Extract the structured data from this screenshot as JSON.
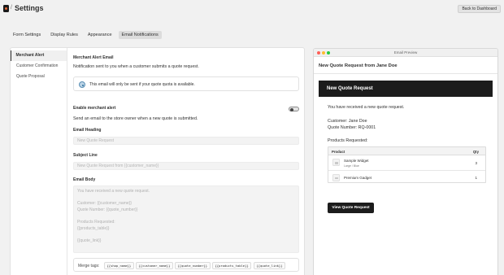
{
  "header": {
    "separator": "/",
    "title": "Settings",
    "back_button": "Back to Dashboard"
  },
  "tabs": [
    {
      "label": "Form Settings"
    },
    {
      "label": "Display Rules"
    },
    {
      "label": "Appearance"
    },
    {
      "label": "Email Notifications",
      "active": true
    }
  ],
  "sidebar": {
    "items": [
      {
        "label": "Merchant Alert",
        "active": true
      },
      {
        "label": "Customer Confirmation"
      },
      {
        "label": "Quote Proposal"
      }
    ]
  },
  "merchant_alert": {
    "title": "Merchant Alert Email",
    "description": "Notification sent to you when a customer submits a quote request.",
    "info": "This email will only be sent if your quote quota is available.",
    "toggle_label": "Enable merchant alert",
    "toggle_on": false,
    "toggle_description": "Send an email to the store owner when a new quote is submitted.",
    "heading_label": "Email Heading",
    "heading_placeholder": "New Quote Request",
    "subject_label": "Subject Line",
    "subject_placeholder": "New Quote Request from {{customer_name}}",
    "body_label": "Email Body",
    "body_lines": [
      "You have received a new quote request.",
      "",
      "Customer: {{customer_name}}",
      "Quote Number: {{quote_number}}",
      "",
      "Products Requested:",
      "{{products_table}}",
      "",
      "{{quote_link}}"
    ],
    "merge_label": "Merge tags:",
    "merge_tags": [
      "{{shop_name}}",
      "{{customer_name}}",
      "{{quote_number}}",
      "{{products_table}}",
      "{{quote_link}}"
    ]
  },
  "preview": {
    "window_title": "Email Preview",
    "subject": "New Quote Request from Jane Doe",
    "heading": "New Quote Request",
    "intro": "You have received a new quote request.",
    "customer": "Customer: Jane Doe",
    "quote_number": "Quote Number: RQ-0001",
    "products_label": "Products Requested:",
    "table_headers": {
      "product": "Product",
      "qty": "Qty"
    },
    "products": [
      {
        "name": "Sample Widget",
        "variant": "Large / Blue",
        "qty": "3"
      },
      {
        "name": "Premium Gadget",
        "variant": "",
        "qty": "1"
      }
    ],
    "button": "View Quote Request"
  },
  "colors": {
    "accent": "#1c1c1c",
    "page_bg": "#f1f1f1",
    "window_dot_red": "#ff5f57",
    "window_dot_yellow": "#febc2e",
    "window_dot_green": "#28c840"
  }
}
